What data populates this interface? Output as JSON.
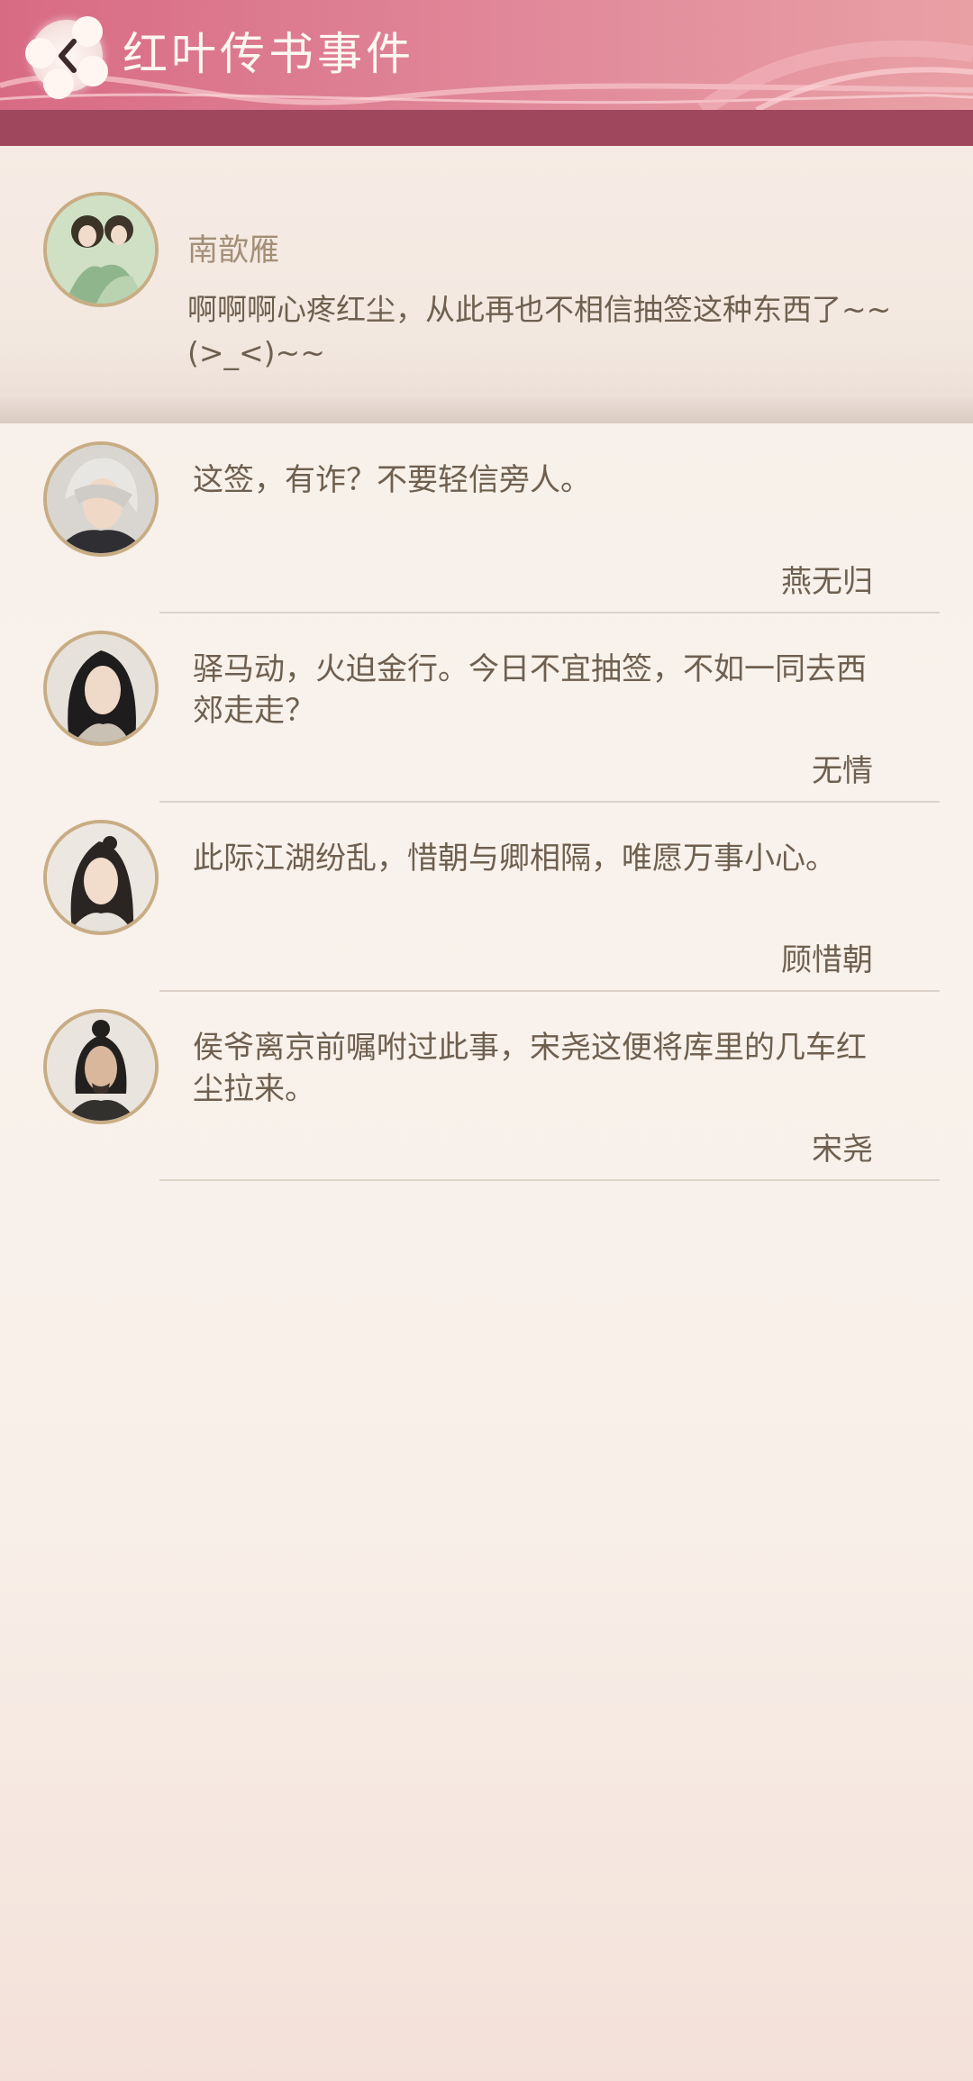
{
  "header": {
    "title": "红叶传书事件",
    "colors": {
      "bar": "#d86b84",
      "band": "#9e475d"
    }
  },
  "post": {
    "author": "南歆雁",
    "text": "啊啊啊心疼红尘，从此再也不相信抽签这种东西了~~(>_<)~~"
  },
  "comments": [
    {
      "text": "这签，有诈？不要轻信旁人。",
      "author": "燕无归"
    },
    {
      "text": "驿马动，火迫金行。今日不宜抽签，不如一同去西郊走走？",
      "author": "无情"
    },
    {
      "text": "此际江湖纷乱，惜朝与卿相隔，唯愿万事小心。",
      "author": "顾惜朝"
    },
    {
      "text": "侯爷离京前嘱咐过此事，宋尧这便将库里的几车红尘拉来。",
      "author": "宋尧"
    }
  ]
}
